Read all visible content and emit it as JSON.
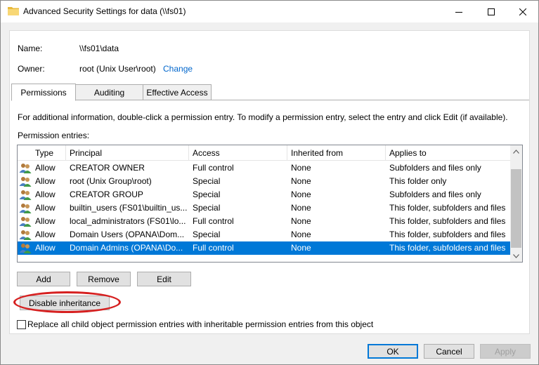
{
  "window": {
    "title": "Advanced Security Settings for data (\\\\fs01)"
  },
  "info": {
    "name_label": "Name:",
    "name_value": "\\\\fs01\\data",
    "owner_label": "Owner:",
    "owner_value": "root (Unix User\\root)",
    "change_link": "Change"
  },
  "tabs": [
    {
      "label": "Permissions",
      "active": true
    },
    {
      "label": "Auditing",
      "active": false
    },
    {
      "label": "Effective Access",
      "active": false
    }
  ],
  "permissions": {
    "info_text": "For additional information, double-click a permission entry. To modify a permission entry, select the entry and click Edit (if available).",
    "entries_label": "Permission entries:",
    "columns": [
      "Type",
      "Principal",
      "Access",
      "Inherited from",
      "Applies to"
    ],
    "rows": [
      {
        "type": "Allow",
        "principal": "CREATOR OWNER",
        "access": "Full control",
        "inherited": "None",
        "applies": "Subfolders and files only"
      },
      {
        "type": "Allow",
        "principal": "root (Unix Group\\root)",
        "access": "Special",
        "inherited": "None",
        "applies": "This folder only"
      },
      {
        "type": "Allow",
        "principal": "CREATOR GROUP",
        "access": "Special",
        "inherited": "None",
        "applies": "Subfolders and files only"
      },
      {
        "type": "Allow",
        "principal": "builtin_users (FS01\\builtin_us...",
        "access": "Special",
        "inherited": "None",
        "applies": "This folder, subfolders and files"
      },
      {
        "type": "Allow",
        "principal": "local_administrators (FS01\\lo...",
        "access": "Full control",
        "inherited": "None",
        "applies": "This folder, subfolders and files"
      },
      {
        "type": "Allow",
        "principal": "Domain Users (OPANA\\Dom...",
        "access": "Special",
        "inherited": "None",
        "applies": "This folder, subfolders and files"
      },
      {
        "type": "Allow",
        "principal": "Domain Admins (OPANA\\Do...",
        "access": "Full control",
        "inherited": "None",
        "applies": "This folder, subfolders and files",
        "selected": true
      }
    ],
    "add_label": "Add",
    "remove_label": "Remove",
    "edit_label": "Edit",
    "disable_inheritance_label": "Disable inheritance",
    "replace_checkbox_label": "Replace all child object permission entries with inheritable permission entries from this object",
    "replace_checked": false
  },
  "footer": {
    "ok_label": "OK",
    "cancel_label": "Cancel",
    "apply_label": "Apply"
  },
  "colors": {
    "selection": "#0078d7",
    "link": "#0066cc",
    "annotation_ring": "#d62020"
  },
  "icons": {
    "title": "folder-icon",
    "row": "users-icon"
  }
}
